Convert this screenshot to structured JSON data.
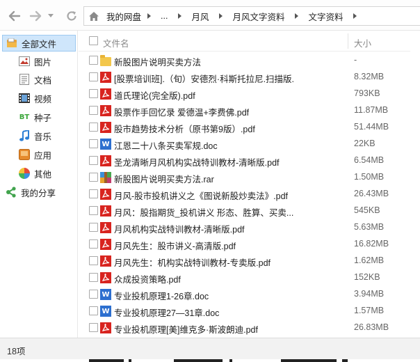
{
  "toolbar": {
    "back_icon": "arrow-left-icon",
    "forward_icon": "arrow-right-icon",
    "refresh_icon": "refresh-icon",
    "home_icon": "home-icon",
    "breadcrumbs": [
      "我的网盘",
      "...",
      "月风",
      "月风文字资料",
      "文字资料"
    ]
  },
  "sidebar": {
    "items": [
      {
        "label": "全部文件",
        "icon": "all-files-icon",
        "active": true
      },
      {
        "label": "图片",
        "icon": "picture-icon"
      },
      {
        "label": "文档",
        "icon": "document-icon"
      },
      {
        "label": "视频",
        "icon": "video-icon"
      },
      {
        "label": "种子",
        "icon": "bt-icon",
        "glyph": "BT"
      },
      {
        "label": "音乐",
        "icon": "music-icon"
      },
      {
        "label": "应用",
        "icon": "app-icon"
      },
      {
        "label": "其他",
        "icon": "other-icon"
      },
      {
        "label": "我的分享",
        "icon": "share-icon"
      }
    ]
  },
  "list": {
    "header": {
      "name": "文件名",
      "size": "大小"
    },
    "files": [
      {
        "name": "新股图片说明买卖方法",
        "size": "-",
        "type": "folder"
      },
      {
        "name": "[股票培训班].（旬）安德烈·科斯托拉尼.扫描版...",
        "size": "8.32MB",
        "type": "pdf"
      },
      {
        "name": "道氏理论(完全版).pdf",
        "size": "793KB",
        "type": "pdf"
      },
      {
        "name": "股票作手回忆录 爱德温+李费佛.pdf",
        "size": "11.87MB",
        "type": "pdf"
      },
      {
        "name": "股市趋势技术分析（原书第9版）.pdf",
        "size": "51.44MB",
        "type": "pdf"
      },
      {
        "name": "江恩二十八条买卖军规.doc",
        "size": "22KB",
        "type": "doc"
      },
      {
        "name": "圣龙清晰月风机构实战特训教材-清晰版.pdf",
        "size": "6.54MB",
        "type": "pdf"
      },
      {
        "name": "新股图片说明买卖方法.rar",
        "size": "1.50MB",
        "type": "rar"
      },
      {
        "name": "月风-股市投机讲义之《图说新股炒卖法》.pdf",
        "size": "26.43MB",
        "type": "pdf"
      },
      {
        "name": "月风：股指期货_投机讲义 形态、胜算、买卖...",
        "size": "545KB",
        "type": "pdf"
      },
      {
        "name": "月风机构实战特训教材-清晰版.pdf",
        "size": "5.63MB",
        "type": "pdf"
      },
      {
        "name": "月风先生：股市讲义-高清版.pdf",
        "size": "16.82MB",
        "type": "pdf"
      },
      {
        "name": "月风先生：机构实战特训教材-专卖版.pdf",
        "size": "1.62MB",
        "type": "pdf"
      },
      {
        "name": "众成投资策略.pdf",
        "size": "152KB",
        "type": "pdf"
      },
      {
        "name": "专业投机原理1-26章.doc",
        "size": "3.94MB",
        "type": "doc"
      },
      {
        "name": "专业投机原理27—31章.doc",
        "size": "1.57MB",
        "type": "doc"
      },
      {
        "name": "专业投机原理[美]维克多·斯波朗迪.pdf",
        "size": "26.83MB",
        "type": "pdf"
      }
    ]
  },
  "status": {
    "count": "18项"
  },
  "colors": {
    "pdf": "#d8241f",
    "doc": "#2d6fcf",
    "folder": "#f3c74b",
    "active_bg": "#cfe6fb"
  }
}
